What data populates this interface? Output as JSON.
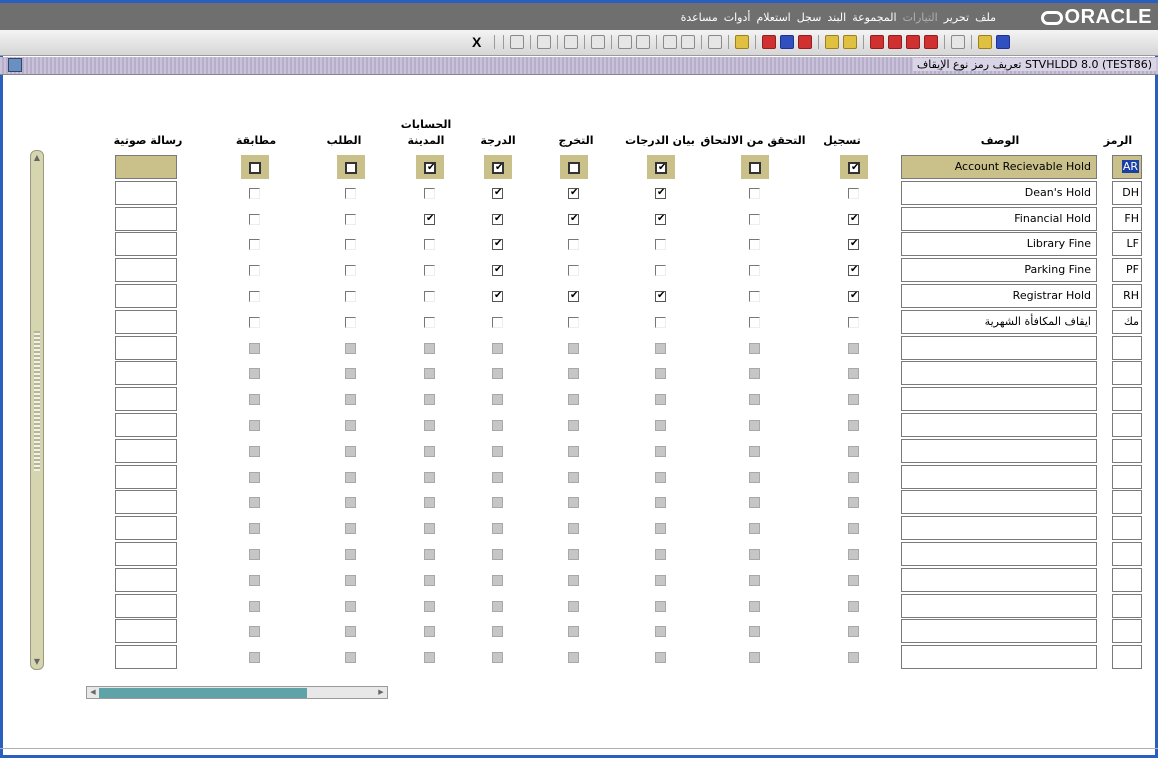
{
  "app": {
    "logo": "ORACLE",
    "menu": [
      "ملف",
      "تحرير",
      "التيارات",
      "المجموعة",
      "البند",
      "سجل",
      "استعلام",
      "أدوات",
      "مساعدة"
    ],
    "menu_dim": [
      "التيارات"
    ],
    "toolbar_exit_label": "X"
  },
  "window": {
    "title": "تعريف رمز نوع الإيقاف STVHLDD 8.0 (TEST86)"
  },
  "columns": {
    "code": "الرمز",
    "description": "الوصف",
    "registration": "تسجيل",
    "enroll_verify": "التحقق من الالتحاق",
    "grades_statement": "بيان الدرجات",
    "graduation": "التخرج",
    "grade": "الدرجة",
    "accounts_receivable_line1": "الحسابات",
    "accounts_receivable_line2": "المدينة",
    "application": "الطلب",
    "compliance": "مطابقة",
    "voice_message": "رسالة صوتية"
  },
  "rows": [
    {
      "code": "AR",
      "description": "Account Recievable Hold",
      "reg": true,
      "enroll": false,
      "stmt": true,
      "grad": false,
      "grade": true,
      "ar": true,
      "app": false,
      "comp": false,
      "selected": true
    },
    {
      "code": "DH",
      "description": "Dean's Hold",
      "reg": false,
      "enroll": false,
      "stmt": true,
      "grad": true,
      "grade": true,
      "ar": false,
      "app": false,
      "comp": false
    },
    {
      "code": "FH",
      "description": "Financial Hold",
      "reg": true,
      "enroll": false,
      "stmt": true,
      "grad": true,
      "grade": true,
      "ar": true,
      "app": false,
      "comp": false
    },
    {
      "code": "LF",
      "description": "Library Fine",
      "reg": true,
      "enroll": false,
      "stmt": false,
      "grad": false,
      "grade": true,
      "ar": false,
      "app": false,
      "comp": false
    },
    {
      "code": "PF",
      "description": "Parking Fine",
      "reg": true,
      "enroll": false,
      "stmt": false,
      "grad": false,
      "grade": true,
      "ar": false,
      "app": false,
      "comp": false
    },
    {
      "code": "RH",
      "description": "Registrar Hold",
      "reg": true,
      "enroll": false,
      "stmt": true,
      "grad": true,
      "grade": true,
      "ar": false,
      "app": false,
      "comp": false
    },
    {
      "code": "مك",
      "description": "ايقاف المكافأة الشهرية",
      "reg": false,
      "enroll": false,
      "stmt": false,
      "grad": false,
      "grade": false,
      "ar": false,
      "app": false,
      "comp": false
    }
  ],
  "empty_rows": 13
}
